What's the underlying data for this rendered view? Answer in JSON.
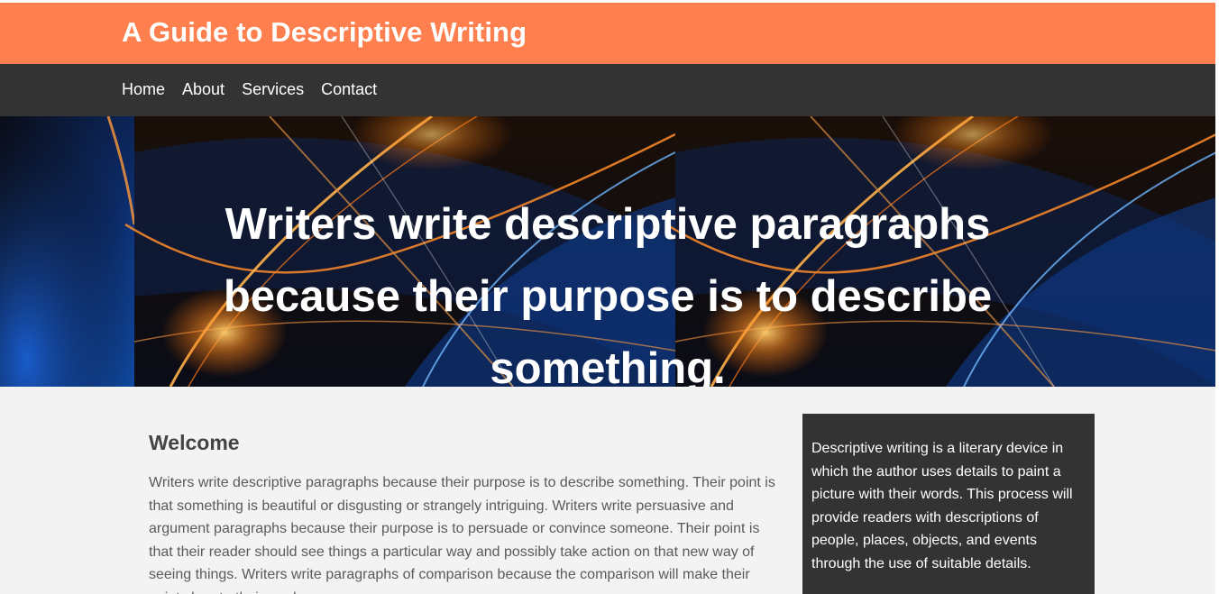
{
  "site": {
    "title": "A Guide to Descriptive Writing"
  },
  "nav": {
    "items": [
      {
        "label": "Home"
      },
      {
        "label": "About"
      },
      {
        "label": "Services"
      },
      {
        "label": "Contact"
      }
    ]
  },
  "hero": {
    "headline": "Writers write descriptive paragraphs because their purpose is to describe something."
  },
  "main": {
    "heading": "Welcome",
    "body": "Writers write descriptive paragraphs because their purpose is to describe something. Their point is that something is beautiful or disgusting or strangely intriguing. Writers write persuasive and argument paragraphs because their purpose is to persuade or convince someone. Their point is that their reader should see things a particular way and possibly take action on that new way of seeing things. Writers write paragraphs of comparison because the comparison will make their point clear to their readers."
  },
  "sidebar": {
    "text": "Descriptive writing is a literary device in which the author uses details to paint a picture with their words. This process will provide readers with descriptions of people, places, objects, and events through the use of suitable details."
  },
  "colors": {
    "header_bg": "#ff7f4f",
    "nav_bg": "#333333",
    "page_bg": "#f3f3f3",
    "sidebar_bg": "#333333",
    "text_heading": "#444444",
    "text_body": "#5a5a5a"
  }
}
